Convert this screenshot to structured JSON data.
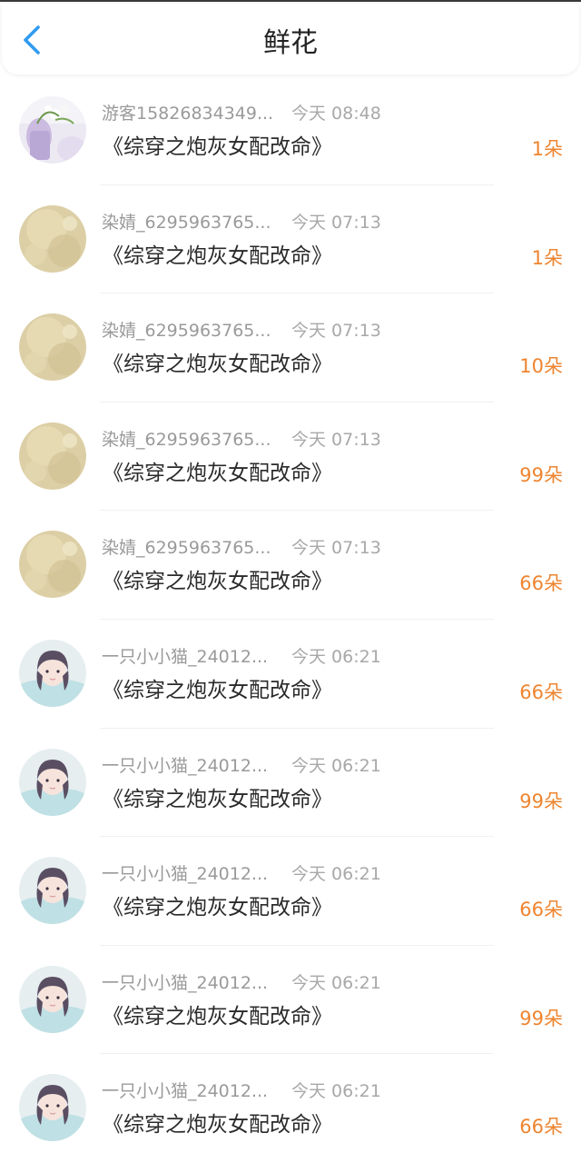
{
  "header": {
    "title": "鲜花",
    "back_icon": "chevron-left-icon",
    "accent_color": "#2f9bf0"
  },
  "colors": {
    "flower_count": "#ee8530",
    "username": "#9a9a9a",
    "time": "#a8a8a8",
    "book_title": "#2a2a2a"
  },
  "items": [
    {
      "avatar": "flowers-photo",
      "username": "游客15826834349...",
      "time": "今天 08:48",
      "book": "《综穿之炮灰女配改命》",
      "flowers": "1朵"
    },
    {
      "avatar": "gold-glitter",
      "username": "染婧_6295963765...",
      "time": "今天 07:13",
      "book": "《综穿之炮灰女配改命》",
      "flowers": "1朵"
    },
    {
      "avatar": "gold-glitter",
      "username": "染婧_6295963765...",
      "time": "今天 07:13",
      "book": "《综穿之炮灰女配改命》",
      "flowers": "10朵"
    },
    {
      "avatar": "gold-glitter",
      "username": "染婧_6295963765...",
      "time": "今天 07:13",
      "book": "《综穿之炮灰女配改命》",
      "flowers": "99朵"
    },
    {
      "avatar": "gold-glitter",
      "username": "染婧_6295963765...",
      "time": "今天 07:13",
      "book": "《综穿之炮灰女配改命》",
      "flowers": "66朵"
    },
    {
      "avatar": "girl-portrait",
      "username": "一只小小猫_24012...",
      "time": "今天 06:21",
      "book": "《综穿之炮灰女配改命》",
      "flowers": "66朵"
    },
    {
      "avatar": "girl-portrait",
      "username": "一只小小猫_24012...",
      "time": "今天 06:21",
      "book": "《综穿之炮灰女配改命》",
      "flowers": "99朵"
    },
    {
      "avatar": "girl-portrait",
      "username": "一只小小猫_24012...",
      "time": "今天 06:21",
      "book": "《综穿之炮灰女配改命》",
      "flowers": "66朵"
    },
    {
      "avatar": "girl-portrait",
      "username": "一只小小猫_24012...",
      "time": "今天 06:21",
      "book": "《综穿之炮灰女配改命》",
      "flowers": "99朵"
    },
    {
      "avatar": "girl-portrait",
      "username": "一只小小猫_24012...",
      "time": "今天 06:21",
      "book": "《综穿之炮灰女配改命》",
      "flowers": "66朵"
    }
  ]
}
